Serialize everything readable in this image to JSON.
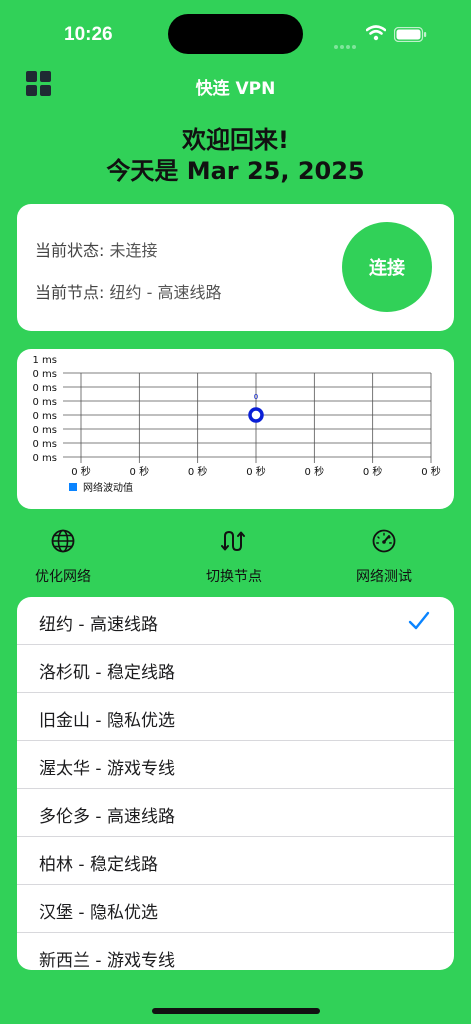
{
  "status_bar": {
    "time": "10:26"
  },
  "header": {
    "title": "快连 VPN",
    "menu_icon": "grid-menu-icon"
  },
  "welcome": {
    "line1": "欢迎回来!",
    "line2": "今天是 Mar 25, 2025"
  },
  "status_card": {
    "state_label": "当前状态:",
    "state_value": "未连接",
    "node_label": "当前节点:",
    "node_value": "纽约 - 高速线路",
    "connect_label": "连接"
  },
  "chart_data": {
    "type": "line",
    "y_tick_labels": [
      "1 ms",
      "0 ms",
      "0 ms",
      "0 ms",
      "0 ms",
      "0 ms",
      "0 ms",
      "0 ms"
    ],
    "x_tick_labels": [
      "0 秒",
      "0 秒",
      "0 秒",
      "0 秒",
      "0 秒",
      "0 秒",
      "0 秒"
    ],
    "series": [
      {
        "name": "网络波动值",
        "color": "#0a84ff",
        "points": [
          {
            "x": 0,
            "y": 0
          }
        ],
        "point_label": "0"
      }
    ],
    "grid": true,
    "legend": "bottom-left"
  },
  "actions": [
    {
      "label": "优化网络",
      "icon": "globe-icon"
    },
    {
      "label": "切换节点",
      "icon": "switch-arrows-icon"
    },
    {
      "label": "网络测试",
      "icon": "speedometer-icon"
    }
  ],
  "nodes": [
    {
      "name": "纽约 - 高速线路",
      "selected": true
    },
    {
      "name": "洛杉矶 - 稳定线路",
      "selected": false
    },
    {
      "name": "旧金山 - 隐私优选",
      "selected": false
    },
    {
      "name": "渥太华 - 游戏专线",
      "selected": false
    },
    {
      "name": "多伦多 - 高速线路",
      "selected": false
    },
    {
      "name": "柏林 - 稳定线路",
      "selected": false
    },
    {
      "name": "汉堡 - 隐私优选",
      "selected": false
    },
    {
      "name": "新西兰 - 游戏专线",
      "selected": false
    }
  ],
  "colors": {
    "background": "#31d158",
    "accent": "#0a84ff",
    "card": "#ffffff"
  }
}
